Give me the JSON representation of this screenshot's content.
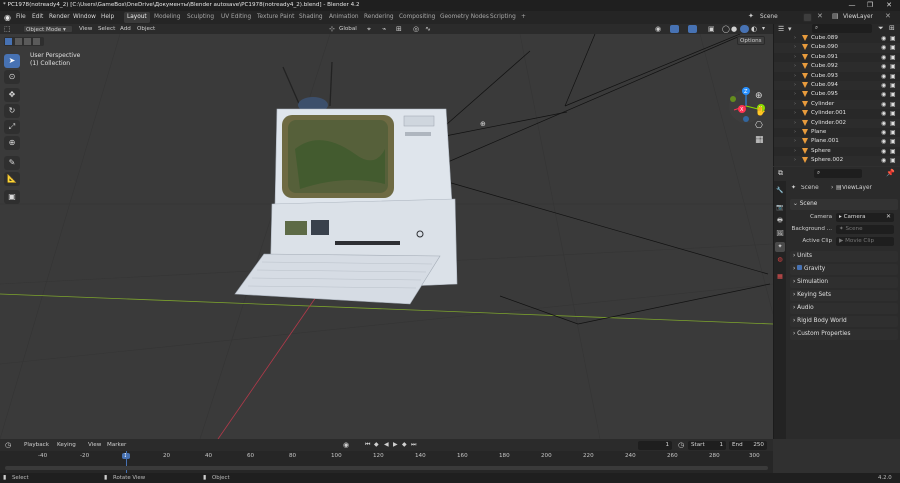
{
  "window": {
    "title": "* PC1978(notready4_2) [C:\\Users\\GameBox\\OneDrive\\Документы\\Blender autosave\\PC1978(notready4_2).blend] - Blender 4.2",
    "controls": [
      "—",
      "❐",
      "✕"
    ]
  },
  "menu": {
    "items": [
      "File",
      "Edit",
      "Render",
      "Window",
      "Help"
    ],
    "workspaces": [
      "Layout",
      "Modeling",
      "Sculpting",
      "UV Editing",
      "Texture Paint",
      "Shading",
      "Animation",
      "Rendering",
      "Compositing",
      "Geometry Nodes",
      "Scripting"
    ],
    "active_workspace": "Layout",
    "add_tab": "+",
    "scene": "Scene",
    "view_layer": "ViewLayer"
  },
  "viewport_header": {
    "mode": "Object Mode",
    "menus": [
      "View",
      "Select",
      "Add",
      "Object"
    ],
    "orientation": "Global",
    "options": "Options"
  },
  "viewport": {
    "perspective": "User Perspective",
    "collection": "(1) Collection",
    "gizmo_labels": [
      "Z",
      "Y",
      "X"
    ]
  },
  "outliner": {
    "search_placeholder": "",
    "items": [
      {
        "name": "Cube.089",
        "extra": ""
      },
      {
        "name": "Cube.090",
        "extra": ""
      },
      {
        "name": "Cube.091",
        "extra": ""
      },
      {
        "name": "Cube.092",
        "extra": ""
      },
      {
        "name": "Cube.093",
        "extra": ""
      },
      {
        "name": "Cube.094",
        "extra": ""
      },
      {
        "name": "Cube.095",
        "extra": ""
      },
      {
        "name": "Cylinder",
        "extra": ""
      },
      {
        "name": "Cylinder.001",
        "extra": ""
      },
      {
        "name": "Cylinder.002",
        "extra": ""
      },
      {
        "name": "Plane",
        "extra": ""
      },
      {
        "name": "Plane.001",
        "extra": ""
      },
      {
        "name": "Sphere",
        "extra": ""
      },
      {
        "name": "Sphere.002",
        "extra": ""
      }
    ]
  },
  "properties": {
    "breadcrumb_scene": "Scene",
    "breadcrumb_viewlayer": "ViewLayer",
    "section": "Scene",
    "fields": [
      {
        "label": "Camera",
        "value": "Camera"
      },
      {
        "label": "Background ...",
        "value": "Scene"
      },
      {
        "label": "Active Clip",
        "value": "Movie Clip"
      }
    ],
    "panels": [
      "Units",
      "Gravity",
      "Simulation",
      "Keying Sets",
      "Audio",
      "Rigid Body World",
      "Custom Properties"
    ]
  },
  "timeline": {
    "menus": [
      "Playback",
      "Keying",
      "View",
      "Marker"
    ],
    "current_frame": "1",
    "start_label": "Start",
    "start": "1",
    "end_label": "End",
    "end": "250",
    "ticks": [
      "-40",
      "-20",
      "1",
      "20",
      "40",
      "60",
      "80",
      "100",
      "120",
      "140",
      "160",
      "180",
      "200",
      "220",
      "240",
      "260",
      "280",
      "300"
    ]
  },
  "status": {
    "items": [
      "Select",
      "Rotate View",
      "Object"
    ],
    "version": "4.2.0"
  },
  "colors": {
    "accent": "#4772b3",
    "x_axis": "#ff3352",
    "y_axis": "#8bdc00",
    "z_axis": "#2890ff"
  }
}
